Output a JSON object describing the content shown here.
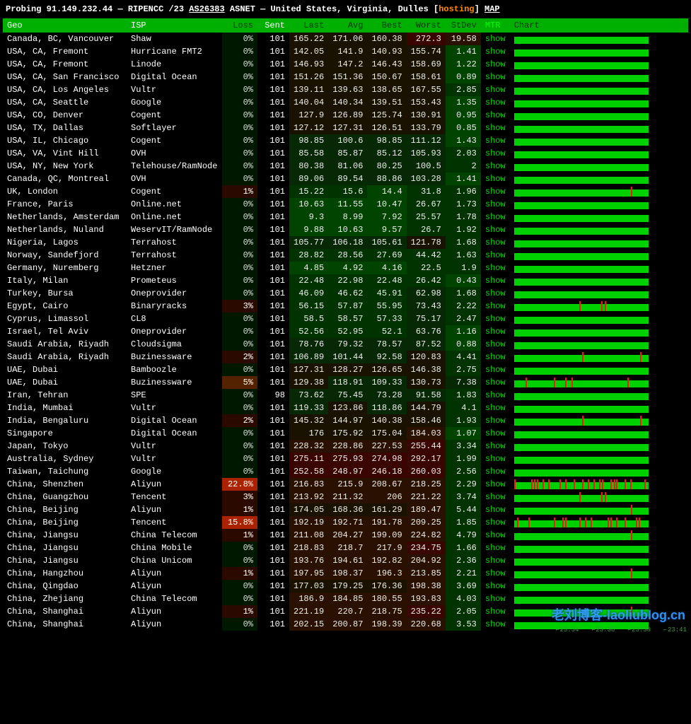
{
  "header": {
    "probing": "Probing",
    "ip": "91.149.232.44",
    "sep": "—",
    "registry": "RIPENCC",
    "cidr": "/23",
    "asn": "AS26383",
    "asname": "ASNET",
    "location": "United States, Virginia, Dulles",
    "hosting": "hosting",
    "map": "MAP"
  },
  "columns": [
    "Geo",
    "ISP",
    "Loss",
    "Sent",
    "Last",
    "Avg",
    "Best",
    "Worst",
    "StDev",
    "MTR",
    "Chart"
  ],
  "mtr_label": "show",
  "watermark": "老刘博客-laoliublog.cn",
  "timeticks": [
    "23:34",
    "23:36",
    "23:38",
    "23:41"
  ],
  "rows": [
    {
      "geo": "Canada, BC, Vancouver",
      "isp": "Shaw",
      "loss": "0%",
      "sent": "101",
      "last": "165.22",
      "avg": "171.06",
      "best": "160.38",
      "worst": "272.3",
      "stdev": "19.58",
      "spikes": 0
    },
    {
      "geo": "USA, CA, Fremont",
      "isp": "Hurricane FMT2",
      "loss": "0%",
      "sent": "101",
      "last": "142.05",
      "avg": "141.9",
      "best": "140.93",
      "worst": "155.74",
      "stdev": "1.41",
      "spikes": 0
    },
    {
      "geo": "USA, CA, Fremont",
      "isp": "Linode",
      "loss": "0%",
      "sent": "101",
      "last": "146.93",
      "avg": "147.2",
      "best": "146.43",
      "worst": "158.69",
      "stdev": "1.22",
      "spikes": 0
    },
    {
      "geo": "USA, CA, San Francisco",
      "isp": "Digital Ocean",
      "loss": "0%",
      "sent": "101",
      "last": "151.26",
      "avg": "151.36",
      "best": "150.67",
      "worst": "158.61",
      "stdev": "0.89",
      "spikes": 0
    },
    {
      "geo": "USA, CA, Los Angeles",
      "isp": "Vultr",
      "loss": "0%",
      "sent": "101",
      "last": "139.11",
      "avg": "139.63",
      "best": "138.65",
      "worst": "167.55",
      "stdev": "2.85",
      "spikes": 0
    },
    {
      "geo": "USA, CA, Seattle",
      "isp": "Google",
      "loss": "0%",
      "sent": "101",
      "last": "140.04",
      "avg": "140.34",
      "best": "139.51",
      "worst": "153.43",
      "stdev": "1.35",
      "spikes": 0
    },
    {
      "geo": "USA, CO, Denver",
      "isp": "Cogent",
      "loss": "0%",
      "sent": "101",
      "last": "127.9",
      "avg": "126.89",
      "best": "125.74",
      "worst": "130.91",
      "stdev": "0.95",
      "spikes": 0
    },
    {
      "geo": "USA, TX, Dallas",
      "isp": "Softlayer",
      "loss": "0%",
      "sent": "101",
      "last": "127.12",
      "avg": "127.31",
      "best": "126.51",
      "worst": "133.79",
      "stdev": "0.85",
      "spikes": 0
    },
    {
      "geo": "USA, IL, Chicago",
      "isp": "Cogent",
      "loss": "0%",
      "sent": "101",
      "last": "98.85",
      "avg": "100.6",
      "best": "98.85",
      "worst": "111.12",
      "stdev": "1.43",
      "spikes": 0
    },
    {
      "geo": "USA, VA, Vint Hill",
      "isp": "OVH",
      "loss": "0%",
      "sent": "101",
      "last": "85.58",
      "avg": "85.87",
      "best": "85.12",
      "worst": "105.93",
      "stdev": "2.03",
      "spikes": 0
    },
    {
      "geo": "USA, NY, New York",
      "isp": "Telehouse/RamNode",
      "loss": "0%",
      "sent": "101",
      "last": "80.38",
      "avg": "81.06",
      "best": "80.25",
      "worst": "100.5",
      "stdev": "2",
      "spikes": 0
    },
    {
      "geo": "Canada, QC, Montreal",
      "isp": "OVH",
      "loss": "0%",
      "sent": "101",
      "last": "89.06",
      "avg": "89.54",
      "best": "88.86",
      "worst": "103.28",
      "stdev": "1.41",
      "spikes": 0
    },
    {
      "geo": "UK, London",
      "isp": "Cogent",
      "loss": "1%",
      "sent": "101",
      "last": "15.22",
      "avg": "15.6",
      "best": "14.4",
      "worst": "31.8",
      "stdev": "1.96",
      "spikes": 1
    },
    {
      "geo": "France, Paris",
      "isp": "Online.net",
      "loss": "0%",
      "sent": "101",
      "last": "10.63",
      "avg": "11.55",
      "best": "10.47",
      "worst": "26.67",
      "stdev": "1.73",
      "spikes": 0
    },
    {
      "geo": "Netherlands, Amsterdam",
      "isp": "Online.net",
      "loss": "0%",
      "sent": "101",
      "last": "9.3",
      "avg": "8.99",
      "best": "7.92",
      "worst": "25.57",
      "stdev": "1.78",
      "spikes": 0
    },
    {
      "geo": "Netherlands, Nuland",
      "isp": "WeservIT/RamNode",
      "loss": "0%",
      "sent": "101",
      "last": "9.88",
      "avg": "10.63",
      "best": "9.57",
      "worst": "26.7",
      "stdev": "1.92",
      "spikes": 0
    },
    {
      "geo": "Nigeria, Lagos",
      "isp": "Terrahost",
      "loss": "0%",
      "sent": "101",
      "last": "105.77",
      "avg": "106.18",
      "best": "105.61",
      "worst": "121.78",
      "stdev": "1.68",
      "spikes": 0
    },
    {
      "geo": "Norway, Sandefjord",
      "isp": "Terrahost",
      "loss": "0%",
      "sent": "101",
      "last": "28.82",
      "avg": "28.56",
      "best": "27.69",
      "worst": "44.42",
      "stdev": "1.63",
      "spikes": 0
    },
    {
      "geo": "Germany, Nuremberg",
      "isp": "Hetzner",
      "loss": "0%",
      "sent": "101",
      "last": "4.85",
      "avg": "4.92",
      "best": "4.16",
      "worst": "22.5",
      "stdev": "1.9",
      "spikes": 0
    },
    {
      "geo": "Italy, Milan",
      "isp": "Prometeus",
      "loss": "0%",
      "sent": "101",
      "last": "22.48",
      "avg": "22.98",
      "best": "22.48",
      "worst": "26.42",
      "stdev": "0.43",
      "spikes": 0
    },
    {
      "geo": "Turkey, Bursa",
      "isp": "Oneprovider",
      "loss": "0%",
      "sent": "101",
      "last": "46.09",
      "avg": "46.62",
      "best": "45.91",
      "worst": "62.98",
      "stdev": "1.68",
      "spikes": 0
    },
    {
      "geo": "Egypt, Cairo",
      "isp": "Binaryracks",
      "loss": "3%",
      "sent": "101",
      "last": "56.15",
      "avg": "57.87",
      "best": "55.95",
      "worst": "73.43",
      "stdev": "2.22",
      "spikes": 3
    },
    {
      "geo": "Cyprus, Limassol",
      "isp": "CL8",
      "loss": "0%",
      "sent": "101",
      "last": "58.5",
      "avg": "58.57",
      "best": "57.33",
      "worst": "75.17",
      "stdev": "2.47",
      "spikes": 0
    },
    {
      "geo": "Israel, Tel Aviv",
      "isp": "Oneprovider",
      "loss": "0%",
      "sent": "101",
      "last": "52.56",
      "avg": "52.95",
      "best": "52.1",
      "worst": "63.76",
      "stdev": "1.16",
      "spikes": 0
    },
    {
      "geo": "Saudi Arabia, Riyadh",
      "isp": "Cloudsigma",
      "loss": "0%",
      "sent": "101",
      "last": "78.76",
      "avg": "79.32",
      "best": "78.57",
      "worst": "87.52",
      "stdev": "0.88",
      "spikes": 0
    },
    {
      "geo": "Saudi Arabia, Riyadh",
      "isp": "Buzinessware",
      "loss": "2%",
      "sent": "101",
      "last": "106.89",
      "avg": "101.44",
      "best": "92.58",
      "worst": "120.83",
      "stdev": "4.41",
      "spikes": 2
    },
    {
      "geo": "UAE, Dubai",
      "isp": "Bamboozle",
      "loss": "0%",
      "sent": "101",
      "last": "127.31",
      "avg": "128.27",
      "best": "126.65",
      "worst": "146.38",
      "stdev": "2.75",
      "spikes": 0
    },
    {
      "geo": "UAE, Dubai",
      "isp": "Buzinessware",
      "loss": "5%",
      "sent": "101",
      "last": "129.38",
      "avg": "118.91",
      "best": "109.33",
      "worst": "130.73",
      "stdev": "7.38",
      "spikes": 5
    },
    {
      "geo": "Iran, Tehran",
      "isp": "SPE",
      "loss": "0%",
      "sent": "98",
      "last": "73.62",
      "avg": "75.45",
      "best": "73.28",
      "worst": "91.58",
      "stdev": "1.83",
      "spikes": 0
    },
    {
      "geo": "India, Mumbai",
      "isp": "Vultr",
      "loss": "0%",
      "sent": "101",
      "last": "119.33",
      "avg": "123.86",
      "best": "118.86",
      "worst": "144.79",
      "stdev": "4.1",
      "spikes": 0
    },
    {
      "geo": "India, Bengaluru",
      "isp": "Digital Ocean",
      "loss": "2%",
      "sent": "101",
      "last": "145.32",
      "avg": "144.97",
      "best": "140.38",
      "worst": "158.46",
      "stdev": "1.93",
      "spikes": 2
    },
    {
      "geo": "Singapore",
      "isp": "Digital Ocean",
      "loss": "0%",
      "sent": "101",
      "last": "176",
      "avg": "175.92",
      "best": "175.04",
      "worst": "184.03",
      "stdev": "1.07",
      "spikes": 0
    },
    {
      "geo": "Japan, Tokyo",
      "isp": "Vultr",
      "loss": "0%",
      "sent": "101",
      "last": "228.32",
      "avg": "228.86",
      "best": "227.53",
      "worst": "255.44",
      "stdev": "3.34",
      "spikes": 0
    },
    {
      "geo": "Australia, Sydney",
      "isp": "Vultr",
      "loss": "0%",
      "sent": "101",
      "last": "275.11",
      "avg": "275.93",
      "best": "274.98",
      "worst": "292.17",
      "stdev": "1.99",
      "spikes": 0
    },
    {
      "geo": "Taiwan, Taichung",
      "isp": "Google",
      "loss": "0%",
      "sent": "101",
      "last": "252.58",
      "avg": "248.97",
      "best": "246.18",
      "worst": "260.03",
      "stdev": "2.56",
      "spikes": 0
    },
    {
      "geo": "China, Shenzhen",
      "isp": "Aliyun",
      "loss": "22.8%",
      "sent": "101",
      "last": "216.83",
      "avg": "215.9",
      "best": "208.67",
      "worst": "218.25",
      "stdev": "2.29",
      "spikes": 25
    },
    {
      "geo": "China, Guangzhou",
      "isp": "Tencent",
      "loss": "3%",
      "sent": "101",
      "last": "213.92",
      "avg": "211.32",
      "best": "206",
      "worst": "221.22",
      "stdev": "3.74",
      "spikes": 3
    },
    {
      "geo": "China, Beijing",
      "isp": "Aliyun",
      "loss": "1%",
      "sent": "101",
      "last": "174.05",
      "avg": "168.36",
      "best": "161.29",
      "worst": "189.47",
      "stdev": "5.44",
      "spikes": 1
    },
    {
      "geo": "China, Beijing",
      "isp": "Tencent",
      "loss": "15.8%",
      "sent": "101",
      "last": "192.19",
      "avg": "192.71",
      "best": "191.78",
      "worst": "209.25",
      "stdev": "1.85",
      "spikes": 16
    },
    {
      "geo": "China, Jiangsu",
      "isp": "China Telecom",
      "loss": "1%",
      "sent": "101",
      "last": "211.08",
      "avg": "204.27",
      "best": "199.09",
      "worst": "224.82",
      "stdev": "4.79",
      "spikes": 1
    },
    {
      "geo": "China, Jiangsu",
      "isp": "China Mobile",
      "loss": "0%",
      "sent": "101",
      "last": "218.83",
      "avg": "218.7",
      "best": "217.9",
      "worst": "234.75",
      "stdev": "1.66",
      "spikes": 0
    },
    {
      "geo": "China, Jiangsu",
      "isp": "China Unicom",
      "loss": "0%",
      "sent": "101",
      "last": "193.76",
      "avg": "194.61",
      "best": "192.82",
      "worst": "204.92",
      "stdev": "2.36",
      "spikes": 0
    },
    {
      "geo": "China, Hangzhou",
      "isp": "Aliyun",
      "loss": "1%",
      "sent": "101",
      "last": "197.95",
      "avg": "198.37",
      "best": "196.3",
      "worst": "213.85",
      "stdev": "2.21",
      "spikes": 1
    },
    {
      "geo": "China, Qingdao",
      "isp": "Aliyun",
      "loss": "0%",
      "sent": "101",
      "last": "177.03",
      "avg": "179.25",
      "best": "176.36",
      "worst": "198.38",
      "stdev": "3.69",
      "spikes": 0
    },
    {
      "geo": "China, Zhejiang",
      "isp": "China Telecom",
      "loss": "0%",
      "sent": "101",
      "last": "186.9",
      "avg": "184.85",
      "best": "180.55",
      "worst": "193.83",
      "stdev": "4.03",
      "spikes": 0
    },
    {
      "geo": "China, Shanghai",
      "isp": "Aliyun",
      "loss": "1%",
      "sent": "101",
      "last": "221.19",
      "avg": "220.7",
      "best": "218.75",
      "worst": "235.22",
      "stdev": "2.05",
      "spikes": 1
    },
    {
      "geo": "China, Shanghai",
      "isp": "Aliyun",
      "loss": "0%",
      "sent": "101",
      "last": "202.15",
      "avg": "200.87",
      "best": "198.39",
      "worst": "220.68",
      "stdev": "3.53",
      "spikes": 0
    }
  ]
}
